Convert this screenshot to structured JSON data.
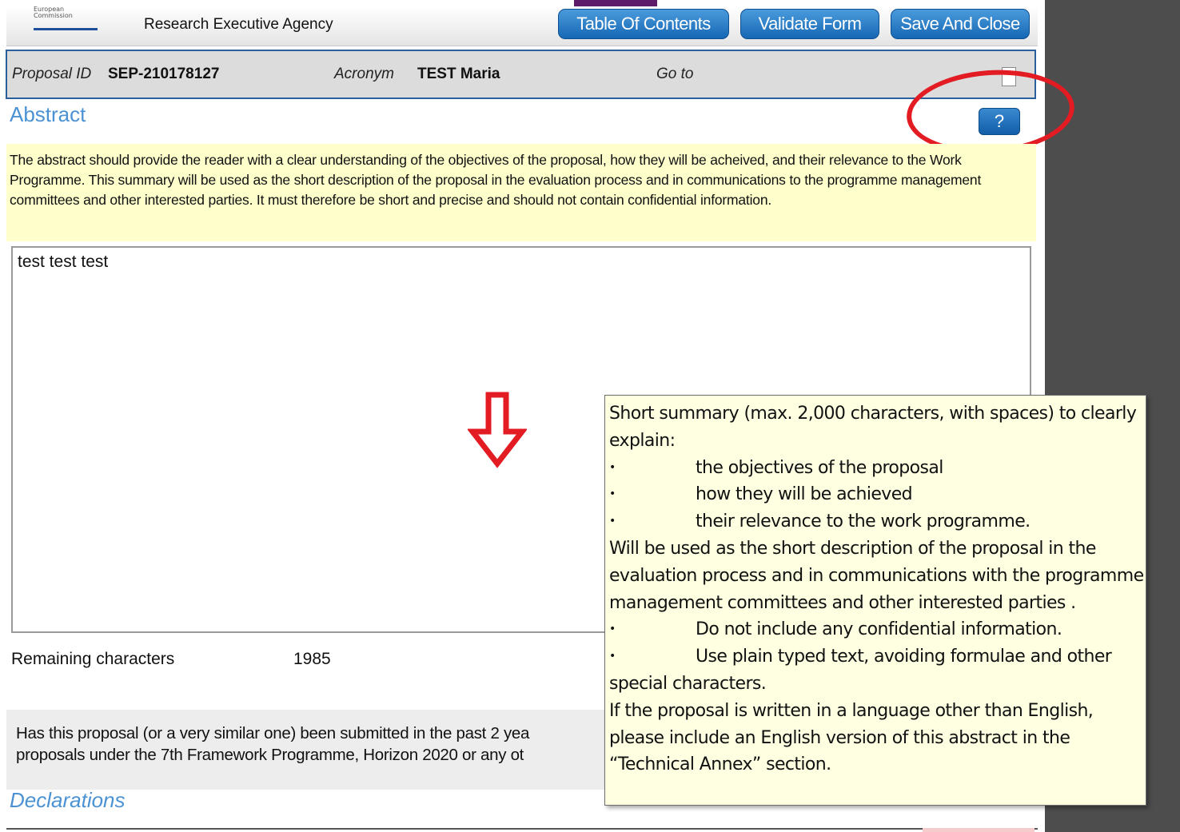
{
  "header": {
    "logo_text_line1": "European",
    "logo_text_line2": "Commission",
    "agency": "Research Executive Agency",
    "buttons": {
      "toc": "Table Of Contents",
      "validate": "Validate Form",
      "save_close": "Save And Close"
    }
  },
  "infobar": {
    "proposal_id_label": "Proposal ID",
    "proposal_id_value": "SEP-210178127",
    "acronym_label": "Acronym",
    "acronym_value": "TEST Maria",
    "goto_label": "Go to"
  },
  "section": {
    "title": "Abstract",
    "help_label": "?",
    "instructions": "The abstract should provide the reader with a clear understanding of the objectives of the proposal, how they will be acheived, and their relevance to the Work Programme. This summary will be used as the short description of the proposal in the evaluation process and in communications to the programme management committees and other interested parties. It must therefore be short and precise and should not contain confidential information.",
    "abstract_value": "test test test"
  },
  "remaining": {
    "label": "Remaining characters",
    "value": "1985"
  },
  "question": {
    "line1": "Has this proposal (or a very similar one) been submitted in the past 2 yea",
    "line2": "proposals under the 7th Framework Programme, Horizon 2020 or any ot"
  },
  "declarations_title": "Declarations",
  "tooltip": {
    "intro": "Short summary (max. 2,000 characters, with spaces) to clearly explain:",
    "bullets": [
      "the objectives of the proposal",
      "how they will be achieved",
      "their relevance to the work programme."
    ],
    "usage": "Will be used as the short description of the proposal in the evaluation process and in communications with the programme management committees and other interested parties .",
    "bullet_confidential": "Do not include any confidential information.",
    "bullet_plain_a": "Use plain typed text, avoiding formulae and other",
    "bullet_plain_b": "special characters.",
    "language_note": "If the proposal is written in a language other than English, please include an English version of this abstract in the “Technical Annex” section."
  },
  "annotation_color": "#e31b23"
}
